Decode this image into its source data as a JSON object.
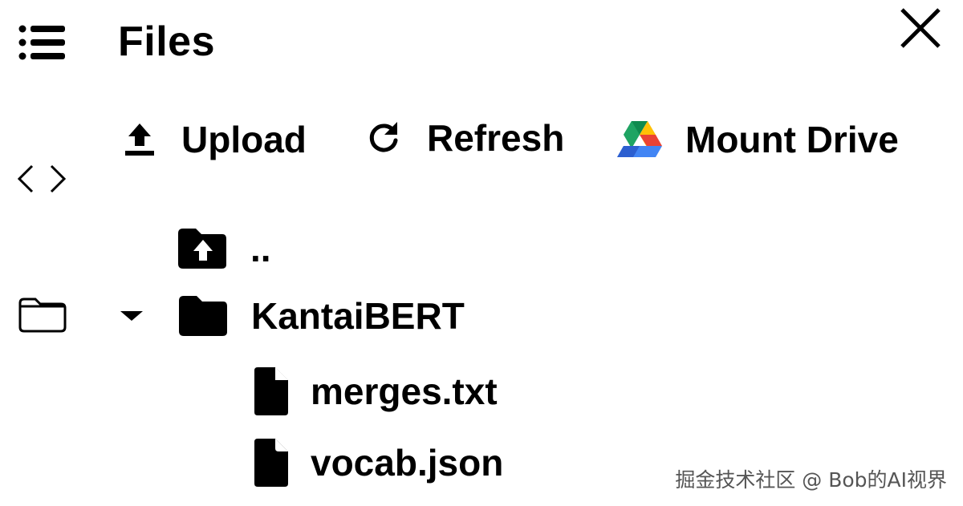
{
  "header": {
    "title": "Files"
  },
  "toolbar": {
    "upload_label": "Upload",
    "refresh_label": "Refresh",
    "mount_label": "Mount Drive"
  },
  "tree": {
    "parent_label": "..",
    "folder_name": "KantaiBERT",
    "files": [
      "merges.txt",
      "vocab.json"
    ]
  },
  "icons": {
    "rail": [
      "menu-icon",
      "code-icon",
      "folder-outline-icon"
    ],
    "close": "close-icon",
    "upload": "upload-icon",
    "refresh": "refresh-icon",
    "mount": "google-drive-icon",
    "parent": "folder-up-icon",
    "folder": "folder-icon",
    "file": "file-icon",
    "caret": "caret-down-icon"
  },
  "colors": {
    "drive_green": "#1fa463",
    "drive_yellow": "#ffc107",
    "drive_blue": "#4285f4",
    "drive_dark_blue": "#2c5fd0",
    "drive_red": "#ea4335",
    "drive_dark_green": "#0f8a4f"
  },
  "watermark": "掘金技术社区 @ Bob的AI视界"
}
